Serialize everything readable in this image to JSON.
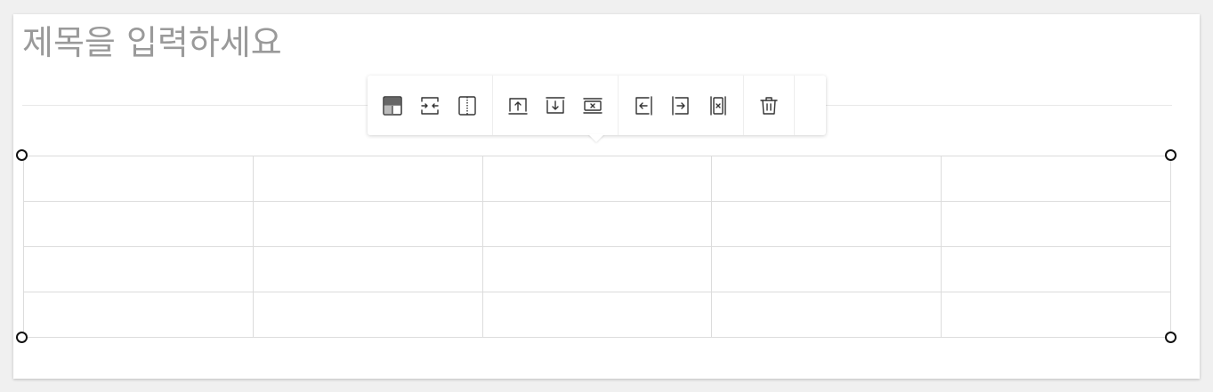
{
  "editor": {
    "title_placeholder": "제목을 입력하세요",
    "title_value": ""
  },
  "table": {
    "rows": 4,
    "columns": 5,
    "cells": [
      [
        "",
        "",
        "",
        "",
        ""
      ],
      [
        "",
        "",
        "",
        "",
        ""
      ],
      [
        "",
        "",
        "",
        "",
        ""
      ],
      [
        "",
        "",
        "",
        "",
        ""
      ]
    ]
  },
  "toolbar": {
    "groups": [
      [
        "header-cell-icon",
        "merge-cells-icon",
        "split-cell-icon"
      ],
      [
        "insert-row-above-icon",
        "insert-row-below-icon",
        "delete-row-icon"
      ],
      [
        "insert-column-left-icon",
        "insert-column-right-icon",
        "delete-column-icon"
      ],
      [
        "trash-icon"
      ]
    ]
  },
  "colors": {
    "card_bg": "#ffffff",
    "page_bg": "#f0f0f0",
    "border": "#dcdcdc",
    "placeholder": "#9a9a9a",
    "icon": "#333333"
  }
}
